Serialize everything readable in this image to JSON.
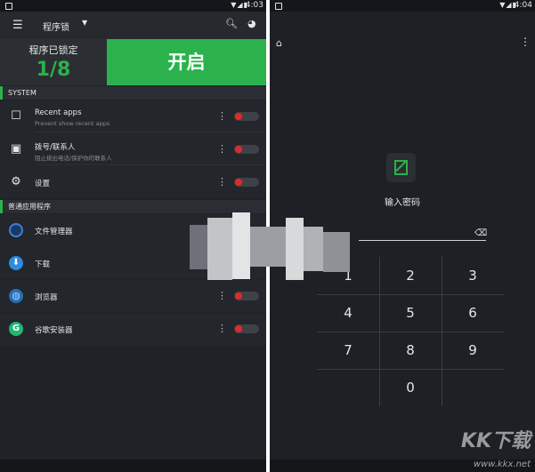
{
  "left": {
    "status_time": "4:03",
    "title": "程序锁",
    "locked_label": "程序已锁定",
    "locked_count": "1/8",
    "open_button": "开启",
    "section_system": "SYSTEM",
    "system_items": [
      {
        "name": "Recent apps",
        "sub": "Prevent show recent apps",
        "icon": "square-icon"
      },
      {
        "name": "拨号/联系人",
        "sub": "阻止拨出电话/保护你的联系人",
        "icon": "contact-card-icon"
      },
      {
        "name": "设置",
        "sub": "",
        "icon": "gear-icon"
      }
    ],
    "section_apps": "普通应用程序",
    "app_items": [
      {
        "name": "文件管理器",
        "icon": "file-manager-icon"
      },
      {
        "name": "下载",
        "icon": "download-icon"
      },
      {
        "name": "浏览器",
        "icon": "globe-icon"
      },
      {
        "name": "谷歌安装器",
        "icon": "google-installer-icon"
      }
    ]
  },
  "right": {
    "status_time": "4:04",
    "prompt": "输入密码",
    "keys": [
      "1",
      "2",
      "3",
      "4",
      "5",
      "6",
      "7",
      "8",
      "9",
      "0"
    ]
  },
  "watermark": {
    "text": "KK下载",
    "url": "www.kkx.net"
  },
  "colors": {
    "accent": "#2bb24c",
    "toggle_knob": "#e02a2a",
    "background": "#1f2227"
  }
}
